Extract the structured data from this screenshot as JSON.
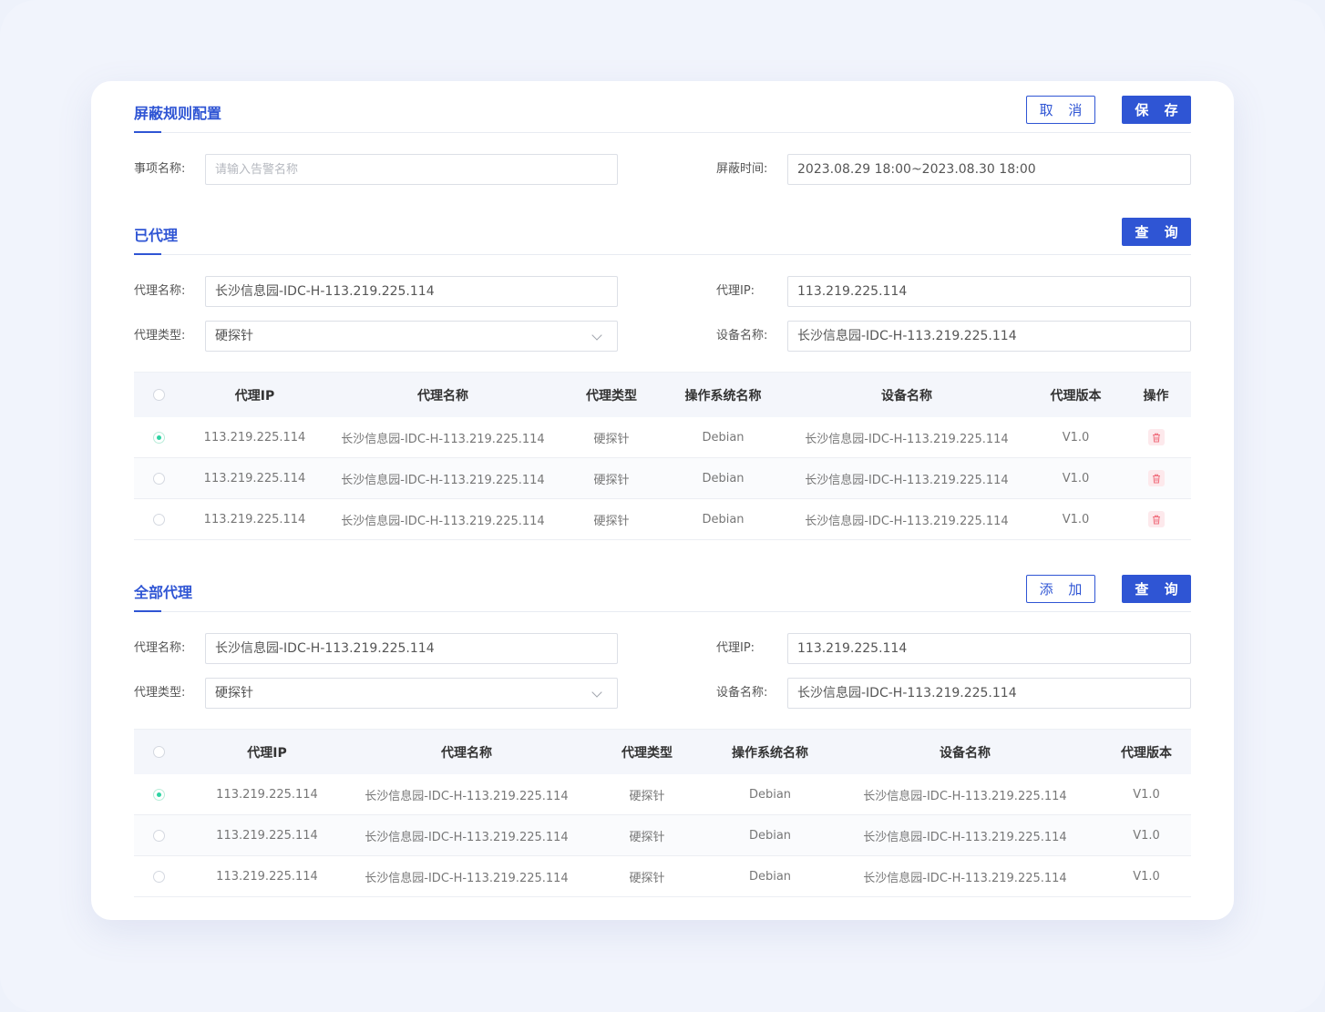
{
  "rule_config": {
    "title": "屏蔽规则配置",
    "cancel_label": "取 消",
    "save_label": "保 存",
    "item_name_label": "事项名称:",
    "item_name_placeholder": "请输入告警名称",
    "shield_time_label": "屏蔽时间:",
    "shield_time_value": "2023.08.29 18:00~2023.08.30 18:00"
  },
  "proxied": {
    "title": "已代理",
    "query_label": "查 询",
    "filters": {
      "proxy_name_label": "代理名称:",
      "proxy_name_value": "长沙信息园-IDC-H-113.219.225.114",
      "proxy_ip_label": "代理IP:",
      "proxy_ip_value": "113.219.225.114",
      "proxy_type_label": "代理类型:",
      "proxy_type_value": "硬探针",
      "device_name_label": "设备名称:",
      "device_name_value": "长沙信息园-IDC-H-113.219.225.114"
    },
    "columns": [
      "代理IP",
      "代理名称",
      "代理类型",
      "操作系统名称",
      "设备名称",
      "代理版本",
      "操作"
    ],
    "rows": [
      {
        "checked": true,
        "ip": "113.219.225.114",
        "name": "长沙信息园-IDC-H-113.219.225.114",
        "type": "硬探针",
        "os": "Debian",
        "device": "长沙信息园-IDC-H-113.219.225.114",
        "version": "V1.0"
      },
      {
        "checked": false,
        "ip": "113.219.225.114",
        "name": "长沙信息园-IDC-H-113.219.225.114",
        "type": "硬探针",
        "os": "Debian",
        "device": "长沙信息园-IDC-H-113.219.225.114",
        "version": "V1.0"
      },
      {
        "checked": false,
        "ip": "113.219.225.114",
        "name": "长沙信息园-IDC-H-113.219.225.114",
        "type": "硬探针",
        "os": "Debian",
        "device": "长沙信息园-IDC-H-113.219.225.114",
        "version": "V1.0"
      }
    ]
  },
  "all_proxies": {
    "title": "全部代理",
    "add_label": "添 加",
    "query_label": "查 询",
    "filters": {
      "proxy_name_label": "代理名称:",
      "proxy_name_value": "长沙信息园-IDC-H-113.219.225.114",
      "proxy_ip_label": "代理IP:",
      "proxy_ip_value": "113.219.225.114",
      "proxy_type_label": "代理类型:",
      "proxy_type_value": "硬探针",
      "device_name_label": "设备名称:",
      "device_name_value": "长沙信息园-IDC-H-113.219.225.114"
    },
    "columns": [
      "代理IP",
      "代理名称",
      "代理类型",
      "操作系统名称",
      "设备名称",
      "代理版本"
    ],
    "rows": [
      {
        "checked": true,
        "ip": "113.219.225.114",
        "name": "长沙信息园-IDC-H-113.219.225.114",
        "type": "硬探针",
        "os": "Debian",
        "device": "长沙信息园-IDC-H-113.219.225.114",
        "version": "V1.0"
      },
      {
        "checked": false,
        "ip": "113.219.225.114",
        "name": "长沙信息园-IDC-H-113.219.225.114",
        "type": "硬探针",
        "os": "Debian",
        "device": "长沙信息园-IDC-H-113.219.225.114",
        "version": "V1.0"
      },
      {
        "checked": false,
        "ip": "113.219.225.114",
        "name": "长沙信息园-IDC-H-113.219.225.114",
        "type": "硬探针",
        "os": "Debian",
        "device": "长沙信息园-IDC-H-113.219.225.114",
        "version": "V1.0"
      }
    ]
  },
  "colors": {
    "primary": "#2f55d4",
    "radio_checked": "#2ed3a3",
    "delete_icon": "#f0717f"
  },
  "icons": {
    "delete": "trash-icon",
    "select": "chevron-down-icon",
    "row_select": "radio-icon"
  }
}
